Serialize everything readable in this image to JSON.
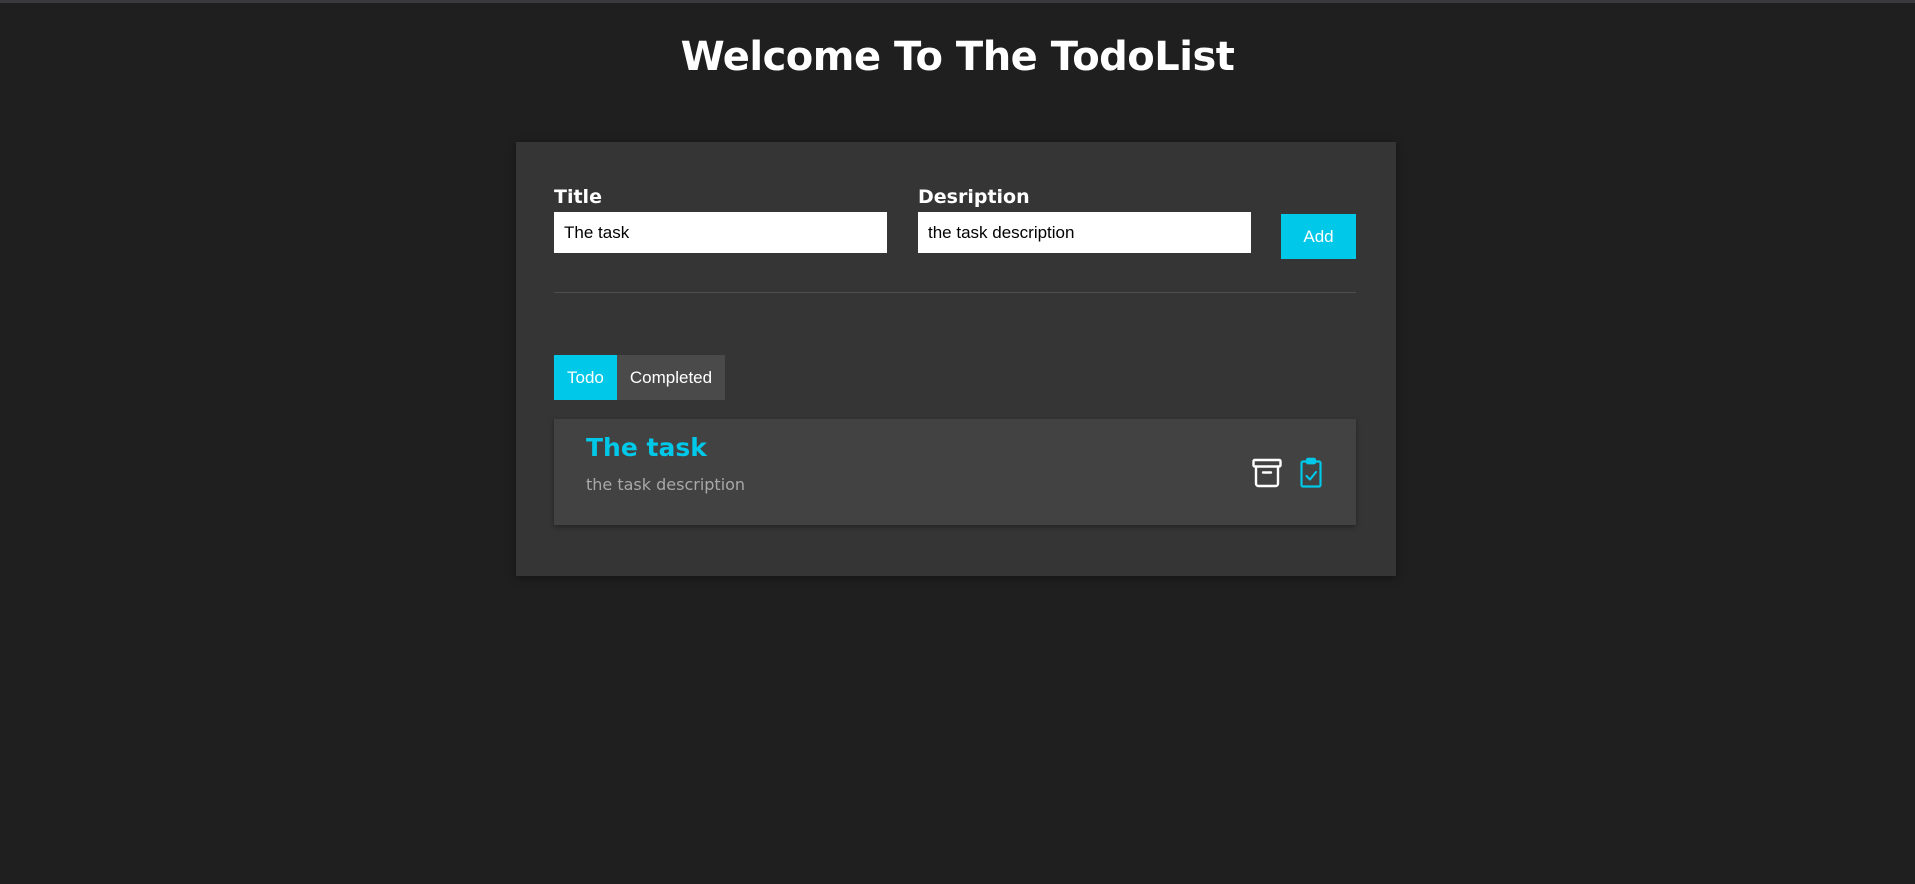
{
  "header": {
    "title": "Welcome To The TodoList"
  },
  "form": {
    "title_label": "Title",
    "title_value": "The task",
    "description_label": "Desription",
    "description_value": "the task description",
    "add_label": "Add"
  },
  "tabs": [
    {
      "label": "Todo",
      "active": true
    },
    {
      "label": "Completed",
      "active": false
    }
  ],
  "todos": [
    {
      "title": "The task",
      "description": "the task description",
      "icons": [
        "archive-icon",
        "clipboard-check-icon"
      ]
    }
  ],
  "colors": {
    "background": "#1f1f1f",
    "panel": "#353535",
    "accent": "#00c8e8",
    "item": "#424242"
  }
}
